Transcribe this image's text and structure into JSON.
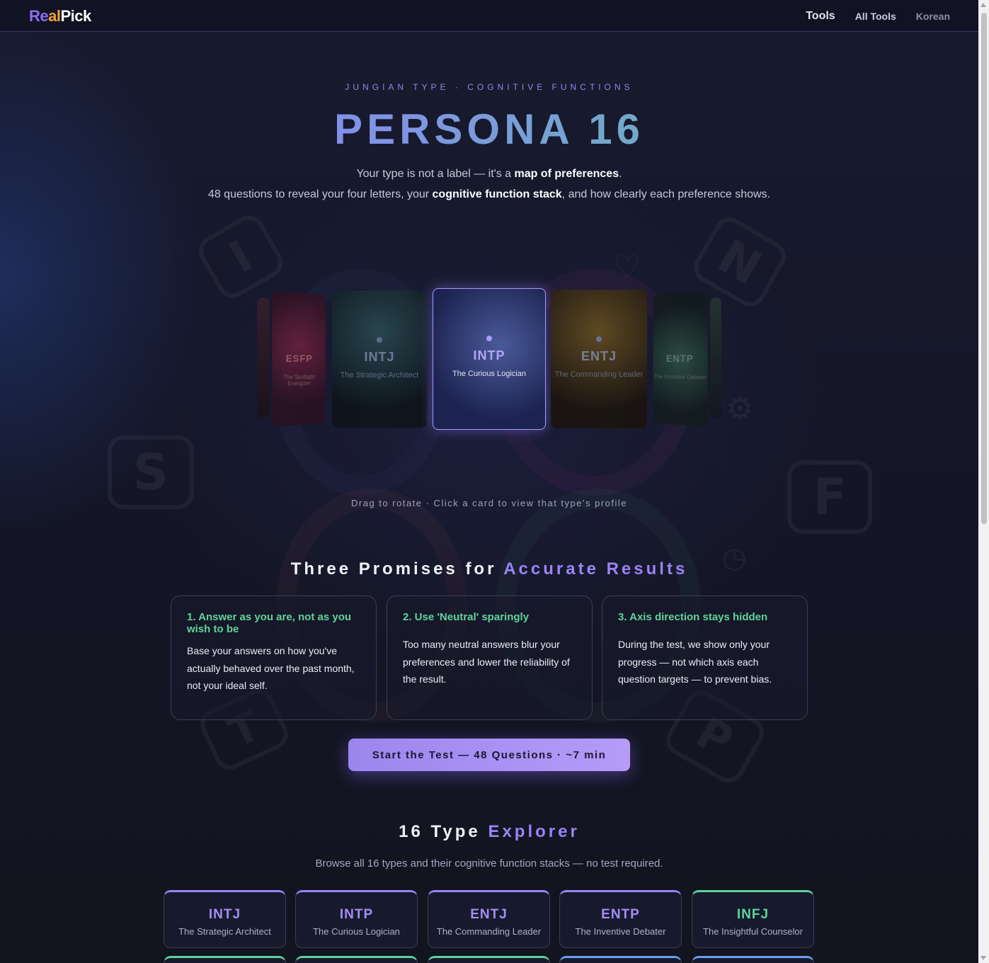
{
  "header": {
    "logo": {
      "part1": "Re",
      "part2": "al",
      "part3": "Pick"
    },
    "nav": {
      "tools": "Tools",
      "all_tools": "All Tools",
      "language": "Korean"
    }
  },
  "hero": {
    "eyebrow": "JUNGIAN TYPE · COGNITIVE FUNCTIONS",
    "title": "PERSONA 16",
    "line1_a": "Your type is not a label — it's a ",
    "line1_b": "map of preferences",
    "line1_c": ".",
    "line2_a": "48 questions to reveal your four letters, your ",
    "line2_b": "cognitive function stack",
    "line2_c": ", and how clearly each preference shows."
  },
  "carousel": {
    "cards": [
      {
        "code": "ESFP",
        "nickname": "The Spotlight Energizer"
      },
      {
        "code": "INTJ",
        "nickname": "The Strategic Architect"
      },
      {
        "code": "INTP",
        "nickname": "The Curious Logician"
      },
      {
        "code": "ENTJ",
        "nickname": "The Commanding Leader"
      },
      {
        "code": "ENTP",
        "nickname": "The Inventive Debater"
      }
    ],
    "hint": "Drag to rotate · Click a card to view that type's profile"
  },
  "promises": {
    "heading_a": "Three Promises for ",
    "heading_b": "Accurate Results",
    "items": [
      {
        "title": "1. Answer as you are, not as you wish to be",
        "body": "Base your answers on how you've actually behaved over the past month, not your ideal self."
      },
      {
        "title": "2. Use 'Neutral' sparingly",
        "body": "Too many neutral answers blur your preferences and lower the reliability of the result."
      },
      {
        "title": "3. Axis direction stays hidden",
        "body": "During the test, we show only your progress — not which axis each question targets — to prevent bias."
      }
    ]
  },
  "cta": {
    "label": "Start the Test — 48 Questions · ~7 min"
  },
  "explorer": {
    "heading_a": "16 Type ",
    "heading_b": "Explorer",
    "subtitle": "Browse all 16 types and their cognitive function stacks — no test required.",
    "types": [
      {
        "code": "INTJ",
        "name": "The Strategic Architect",
        "color": "#a58cf5"
      },
      {
        "code": "INTP",
        "name": "The Curious Logician",
        "color": "#a58cf5"
      },
      {
        "code": "ENTJ",
        "name": "The Commanding Leader",
        "color": "#a58cf5"
      },
      {
        "code": "ENTP",
        "name": "The Inventive Debater",
        "color": "#a58cf5"
      },
      {
        "code": "INFJ",
        "name": "The Insightful Counselor",
        "color": "#5fd39b"
      }
    ]
  },
  "colors": {
    "accent": "#9b83f5",
    "green": "#5fd39b",
    "background": "#141728"
  }
}
